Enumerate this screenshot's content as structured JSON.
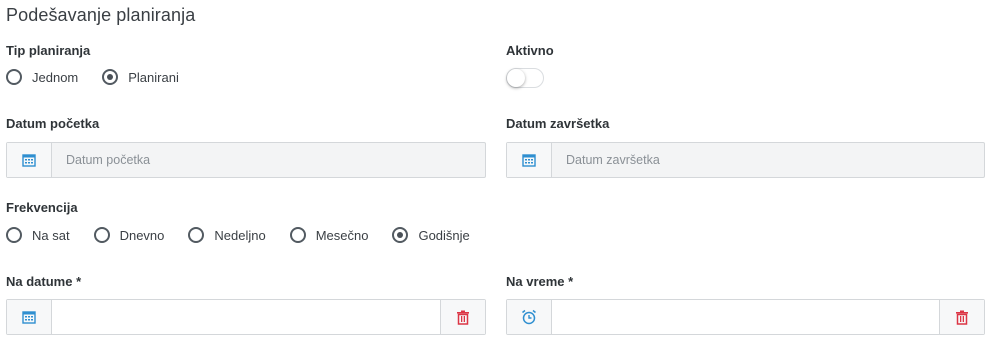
{
  "page": {
    "title": "Podešavanje planiranja"
  },
  "schedule_type": {
    "label": "Tip planiranja",
    "options": [
      {
        "label": "Jednom",
        "checked": false
      },
      {
        "label": "Planirani",
        "checked": true
      }
    ]
  },
  "active": {
    "label": "Aktivno",
    "on": false
  },
  "start_date": {
    "label": "Datum početka",
    "placeholder": "Datum početka",
    "value": ""
  },
  "end_date": {
    "label": "Datum završetka",
    "placeholder": "Datum završetka",
    "value": ""
  },
  "frequency": {
    "label": "Frekvencija",
    "options": [
      {
        "label": "Na sat",
        "checked": false
      },
      {
        "label": "Dnevno",
        "checked": false
      },
      {
        "label": "Nedeljno",
        "checked": false
      },
      {
        "label": "Mesečno",
        "checked": false
      },
      {
        "label": "Godišnje",
        "checked": true
      }
    ]
  },
  "on_dates": {
    "label": "Na datume *",
    "value": ""
  },
  "on_time": {
    "label": "Na vreme *",
    "value": ""
  },
  "colors": {
    "icon_blue": "#2f8fd0",
    "delete_red": "#dc3545",
    "radio_dark": "#495057"
  }
}
